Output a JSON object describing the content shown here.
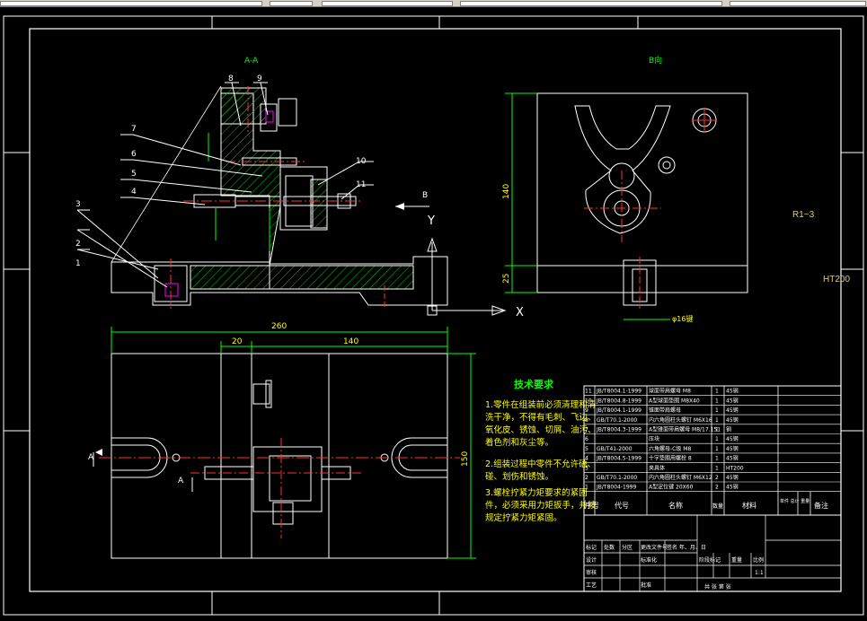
{
  "colors": {
    "background": "#000000",
    "frame": "#ffffff",
    "centerline": "#ff3030",
    "dimension": "#00ff00",
    "hatch": "#00cc00",
    "leader": "#ffffff",
    "note_title": "#00ff00",
    "note_text": "#ffff00",
    "side_text": "#e0d060",
    "accent_part": "#ff00ff"
  },
  "views": {
    "section_label": "A-A",
    "view_b_label": "B向",
    "arrow_b": "B",
    "arrow_a_left": "A",
    "arrow_a_right": "A"
  },
  "ucs": {
    "x": "X",
    "y": "Y"
  },
  "dimensions": {
    "overall_width": "260",
    "left_offset": "20",
    "center_width": "140",
    "overall_height": "150",
    "viewb_height": "140",
    "viewb_base": "25",
    "viewb_bottom": "φ16键"
  },
  "balloons": [
    "1",
    "2",
    "3",
    "4",
    "5",
    "6",
    "7",
    "8",
    "9",
    "10",
    "11"
  ],
  "side_labels": {
    "roughness": "R1~3",
    "material": "HT200"
  },
  "notes": {
    "title": "技术要求",
    "lines": [
      "1.零件在组装前必须清理和清",
      "洗干净，不得有毛刺、飞边、",
      "氧化皮、锈蚀、切屑、油污、",
      "着色剂和灰尘等。",
      "2.组装过程中零件不允许磕、",
      "碰、划伤和锈蚀。",
      "3.螺栓拧紧力矩要求的紧固",
      "件，必须采用力矩扳手，并按",
      "规定拧紧力矩紧固。"
    ]
  },
  "bom": {
    "headers": [
      "序号",
      "代号",
      "名称",
      "数量",
      "材料",
      "单件 总计 重量",
      "备注"
    ],
    "rows": [
      [
        "11",
        "JB/T8004.1-1999",
        "球面带肩螺母 M8",
        "1",
        "45钢"
      ],
      [
        "10",
        "JB/T8004.8-1999",
        "A型球面垫圈 M8X40",
        "1",
        "45钢"
      ],
      [
        "9",
        "JB/T8004.1-1999",
        "锥面带肩螺母",
        "1",
        "45钢"
      ],
      [
        "8",
        "GB/T70.1-2000",
        "内六角圆柱头螺钉 M6X16",
        "1",
        "45钢"
      ],
      [
        "7",
        "JB/T8004.3-1999",
        "A型锥面带肩螺母 M8/17.151",
        "1",
        "钢"
      ],
      [
        "6",
        "",
        "压块",
        "1",
        "45钢"
      ],
      [
        "5",
        "GB/T41-2000",
        "六角螺母-C级 M8",
        "1",
        "45钢"
      ],
      [
        "4",
        "JB/T8004.5-1999",
        "十字垫圈用螺栓 8",
        "1",
        "45钢"
      ],
      [
        "3",
        "",
        "夹具体",
        "1",
        "HT200"
      ],
      [
        "2",
        "GB/T70.1-2000",
        "内六角圆柱头螺钉 M6X12",
        "2",
        "45钢"
      ],
      [
        "1",
        "JB/T8004-1999",
        "A型定位键 20X60",
        "2",
        "45钢"
      ]
    ]
  },
  "title_block": {
    "mark": "标记",
    "count": "处数",
    "zone": "分区",
    "change_doc": "更改文件号",
    "sign_date": "签名 年、月、日",
    "design": "设计",
    "standard": "标准化",
    "review": "审核",
    "process": "工艺",
    "approve": "批准",
    "stage_mark": "阶段标记",
    "weight": "重量",
    "scale": "比例",
    "scale_value": "1:1",
    "sheets": "共  张  第  张"
  }
}
